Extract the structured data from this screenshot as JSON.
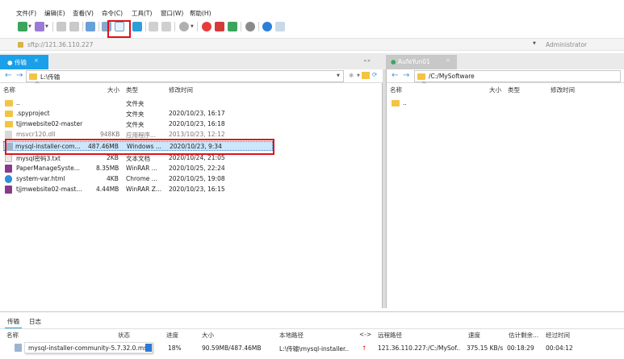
{
  "menu": [
    "文件(F)",
    "编辑(E)",
    "查看(V)",
    "命令(C)",
    "工具(T)",
    "窗口(W)",
    "帮助(H)"
  ],
  "address": {
    "value": "sftp://121.36.110.227",
    "user": "Administrator"
  },
  "tabs": {
    "left": {
      "label": "传输",
      "close": "×"
    },
    "right": {
      "label": "AufeYun01",
      "close": "×"
    }
  },
  "left_pane": {
    "path": "L:\\传输",
    "columns": {
      "name": "名称",
      "size": "大小",
      "type": "类型",
      "modified": "修改时间"
    },
    "files": [
      {
        "name": "..",
        "size": "",
        "type": "文件夹",
        "modified": ""
      },
      {
        "name": ".spyproject",
        "size": "",
        "type": "文件夹",
        "modified": "2020/10/23, 16:17"
      },
      {
        "name": "tjjmwebsite02-master",
        "size": "",
        "type": "文件夹",
        "modified": "2020/10/23, 16:18"
      },
      {
        "name": "msvcr120.dll",
        "size": "948KB",
        "type": "应用程序...",
        "modified": "2013/10/23, 12:12"
      },
      {
        "name": "mysql-installer-com...",
        "size": "487.46MB",
        "type": "Windows ...",
        "modified": "2020/10/23, 9:34"
      },
      {
        "name": "mysql密码3.txt",
        "size": "2KB",
        "type": "文本文档",
        "modified": "2020/10/24, 21:05"
      },
      {
        "name": "PaperManageSyste...",
        "size": "8.35MB",
        "type": "WinRAR ...",
        "modified": "2020/10/25, 22:24"
      },
      {
        "name": "system-var.html",
        "size": "4KB",
        "type": "Chrome ...",
        "modified": "2020/10/25, 19:08"
      },
      {
        "name": "tjjmwebsite02-mast...",
        "size": "4.44MB",
        "type": "WinRAR Z...",
        "modified": "2020/10/23, 16:15"
      }
    ]
  },
  "right_pane": {
    "path": "/C:/MySoftware",
    "columns": {
      "name": "名称",
      "size": "大小",
      "type": "类型",
      "modified": "修改时间"
    },
    "files": [
      {
        "name": ".."
      }
    ]
  },
  "transfer": {
    "tabs": [
      "传输",
      "日志"
    ],
    "columns": {
      "name": "名称",
      "status": "状态",
      "progress": "进度",
      "size": "大小",
      "local": "本地路径",
      "arrow": "<->",
      "remote": "远程路径",
      "speed": "速度",
      "remaining": "估计剩余...",
      "elapsed": "经过时间"
    },
    "row": {
      "name": "mysql-installer-community-5.7.32.0.msi",
      "progress": "18%",
      "progress_value": 0.18,
      "size": "90.59MB/487.46MB",
      "local": "L:\\传输\\mysql-installer..",
      "remote": "121.36.110.227:/C:/MySof..",
      "speed": "375.15 KB/s",
      "remaining": "00:18:29",
      "elapsed": "00:04:12"
    }
  },
  "colors": {
    "accent": "#1aa0e8",
    "highlight": "#e0111a",
    "selection": "#cce6fb",
    "progress": "#2b7bd6"
  }
}
